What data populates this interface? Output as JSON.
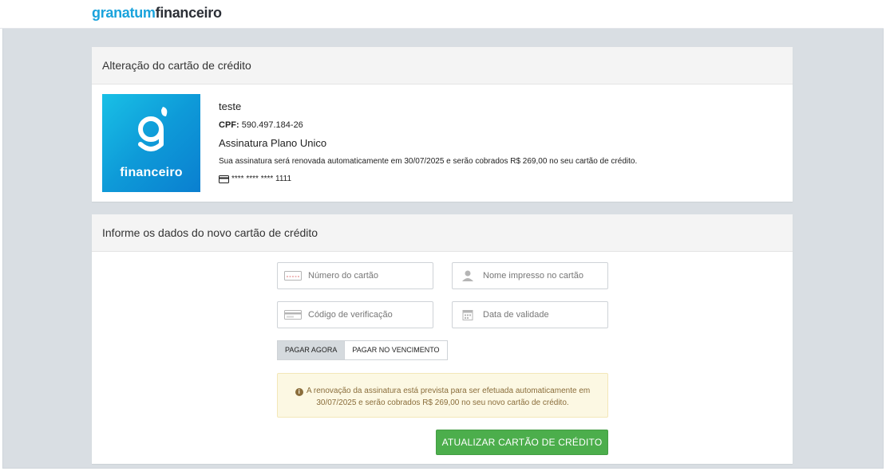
{
  "logo": {
    "part1": "granatum",
    "part2": "financeiro"
  },
  "current_card": {
    "header": "Alteração do cartão de crédito",
    "brand_tile_word": "financeiro",
    "customer_name": "teste",
    "cpf_label": "CPF:",
    "cpf_value": "590.497.184-26",
    "plan": "Assinatura Plano Unico",
    "renewal_text": "Sua assinatura será renovada automaticamente em 30/07/2025 e serão cobrados R$ 269,00 no seu cartão de crédito.",
    "card_masked": "**** **** **** 1111",
    "card_icon": "credit-card-icon"
  },
  "new_card": {
    "header": "Informe os dados do novo cartão de crédito",
    "fields": {
      "card_number": {
        "placeholder": "Número do cartão",
        "value": "",
        "icon": "card-number-icon"
      },
      "card_name": {
        "placeholder": "Nome impresso no cartão",
        "value": "",
        "icon": "user-icon"
      },
      "cvv": {
        "placeholder": "Código de verificação",
        "value": "",
        "icon": "card-back-icon"
      },
      "expiry": {
        "placeholder": "Data de validade",
        "value": "",
        "icon": "calendar-icon"
      }
    },
    "payment_options": {
      "pay_now": "PAGAR AGORA",
      "pay_on_due": "PAGAR NO VENCIMENTO",
      "selected": "PAGAR AGORA"
    },
    "alert_line1": "A renovação da assinatura está prevista para ser efetuada automaticamente em",
    "alert_line2": "30/07/2025 e serão cobrados R$ 269,00 no seu novo cartão de crédito.",
    "submit_label": "ATUALIZAR CARTÃO DE CRÉDITO"
  },
  "colors": {
    "brand_blue": "#0e9ad8",
    "success_green": "#4cae4c",
    "alert_bg": "#fcf8e3",
    "alert_text": "#8a6d3b"
  }
}
